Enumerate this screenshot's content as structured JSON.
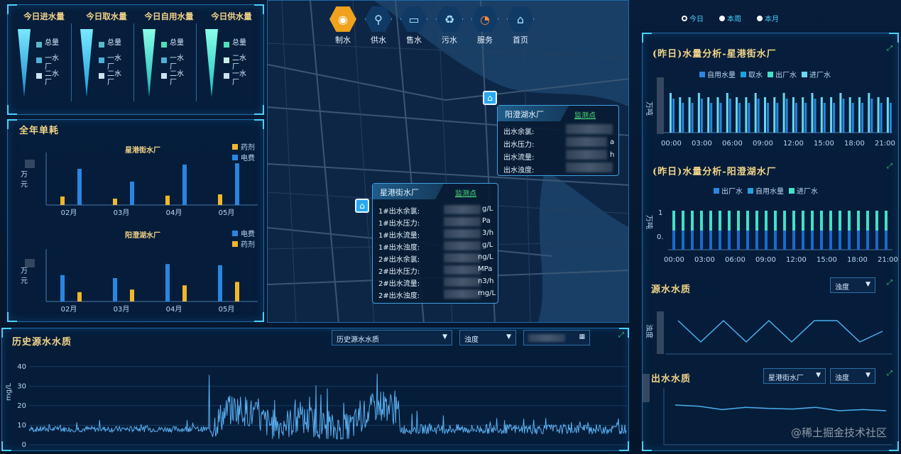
{
  "nav": {
    "items": [
      {
        "label": "制水",
        "icon": "water-drop-icon",
        "active": true
      },
      {
        "label": "供水",
        "icon": "faucet-icon",
        "active": false
      },
      {
        "label": "售水",
        "icon": "meter-icon",
        "active": false
      },
      {
        "label": "污水",
        "icon": "recycle-icon",
        "active": false
      },
      {
        "label": "服务",
        "icon": "service-24h-icon",
        "active": false
      },
      {
        "label": "首页",
        "icon": "home-icon",
        "active": false
      }
    ]
  },
  "today_panel": {
    "columns": [
      {
        "title": "今日进水量",
        "legend": [
          "总量",
          "一水厂",
          "二水厂"
        ]
      },
      {
        "title": "今日取水量",
        "legend": [
          "总量",
          "一水厂",
          "二水厂"
        ]
      },
      {
        "title": "今日自用水量",
        "legend": [
          "总量",
          "一水厂",
          "二水厂"
        ]
      },
      {
        "title": "今日供水量",
        "legend": [
          "总量",
          "二水厂",
          "一水厂"
        ]
      }
    ]
  },
  "annual_panel": {
    "title": "全年单耗",
    "unit": "万元",
    "chart1": {
      "title": "星港街水厂",
      "legend": [
        "药剂",
        "电费"
      ]
    },
    "chart2": {
      "title": "阳澄湖水厂",
      "legend": [
        "电费",
        "药剂"
      ]
    }
  },
  "map": {
    "plant1": {
      "name": "阳澄湖水厂",
      "link": "监测点",
      "rows": [
        "出水余氯:",
        "出水压力:",
        "出水流量:",
        "出水浊度:"
      ],
      "units": [
        "",
        "a",
        "h",
        ""
      ]
    },
    "plant2": {
      "name": "星港街水厂",
      "link": "监测点",
      "rows": [
        "1#出水余氯:",
        "1#出水压力:",
        "1#出水流量:",
        "1#出水浊度:",
        "2#出水余氯:",
        "2#出水压力:",
        "2#出水流量:",
        "2#出水浊度:"
      ],
      "units": [
        "g/L",
        "Pa",
        "3/h",
        "g/L",
        "ng/L",
        "MPa",
        "n3/h",
        "mg/L"
      ]
    }
  },
  "history_panel": {
    "title": "历史源水水质",
    "select1": "历史源水水质",
    "select2": "浊度",
    "ylabel": "mg/L"
  },
  "period_tabs": [
    "今日",
    "本周",
    "本月"
  ],
  "right1": {
    "title": "(昨日)水量分析-星港街水厂",
    "legend": [
      "自用水量",
      "取水",
      "出厂水",
      "进厂水"
    ],
    "ylabel": "万吨"
  },
  "right2": {
    "title": "(昨日)水量分析-阳澄湖水厂",
    "legend": [
      "出厂水",
      "自用水量",
      "进厂水"
    ],
    "ylabel": "万吨"
  },
  "source_quality": {
    "title": "源水水质",
    "select": "浊度",
    "ylabel": "浊度"
  },
  "outflow_quality": {
    "title": "出水水质",
    "select1": "星港街水厂",
    "select2": "浊度"
  },
  "watermark": "@稀土掘金技术社区",
  "colors": {
    "accent": "#4ad0ff",
    "gold": "#f2d489",
    "green": "#4fe07a",
    "bar_blue": "#2a86e0",
    "bar_gold": "#f0b82a",
    "teal": "#43e0c8"
  },
  "chart_data": [
    {
      "type": "bar",
      "title": "星港街水厂",
      "categories": [
        "02月",
        "03月",
        "04月",
        "05月"
      ],
      "series": [
        {
          "name": "药剂",
          "values": [
            0.2,
            0.15,
            0.22,
            0.25
          ]
        },
        {
          "name": "电费",
          "values": [
            0.85,
            0.55,
            0.95,
            0.98
          ]
        }
      ],
      "ylabel": "万元"
    },
    {
      "type": "bar",
      "title": "阳澄湖水厂",
      "categories": [
        "02月",
        "03月",
        "04月",
        "05月"
      ],
      "series": [
        {
          "name": "电费",
          "values": [
            0.62,
            0.55,
            0.88,
            0.85
          ]
        },
        {
          "name": "药剂",
          "values": [
            0.22,
            0.28,
            0.38,
            0.46
          ]
        }
      ],
      "ylabel": "万元"
    },
    {
      "type": "line",
      "title": "历史源水水质",
      "ylabel": "mg/L",
      "ylim": [
        0,
        45
      ],
      "yticks": [
        0,
        10,
        20,
        30,
        40
      ],
      "grid": true
    },
    {
      "type": "bar",
      "title": "(昨日)水量分析-星港街水厂",
      "xticks": [
        "00:00",
        "03:00",
        "06:00",
        "09:00",
        "12:00",
        "15:00",
        "18:00",
        "21:00"
      ],
      "ylabel": "万吨"
    },
    {
      "type": "bar",
      "title": "(昨日)水量分析-阳澄湖水厂",
      "xticks": [
        "00:00",
        "03:00",
        "06:00",
        "09:00",
        "12:00",
        "15:00",
        "18:00",
        "21:00"
      ],
      "yticks": [
        "0.",
        "1"
      ],
      "ylabel": "万吨"
    },
    {
      "type": "line",
      "title": "源水水质",
      "ylabel": "浊度",
      "values": [
        0.9,
        0.3,
        0.9,
        0.3,
        0.9,
        0.3,
        0.9,
        0.9,
        0.3,
        0.6
      ]
    },
    {
      "type": "line",
      "title": "出水水质",
      "values": [
        0.7,
        0.68,
        0.62,
        0.66,
        0.64,
        0.63,
        0.66,
        0.6,
        0.62,
        0.6
      ]
    }
  ]
}
